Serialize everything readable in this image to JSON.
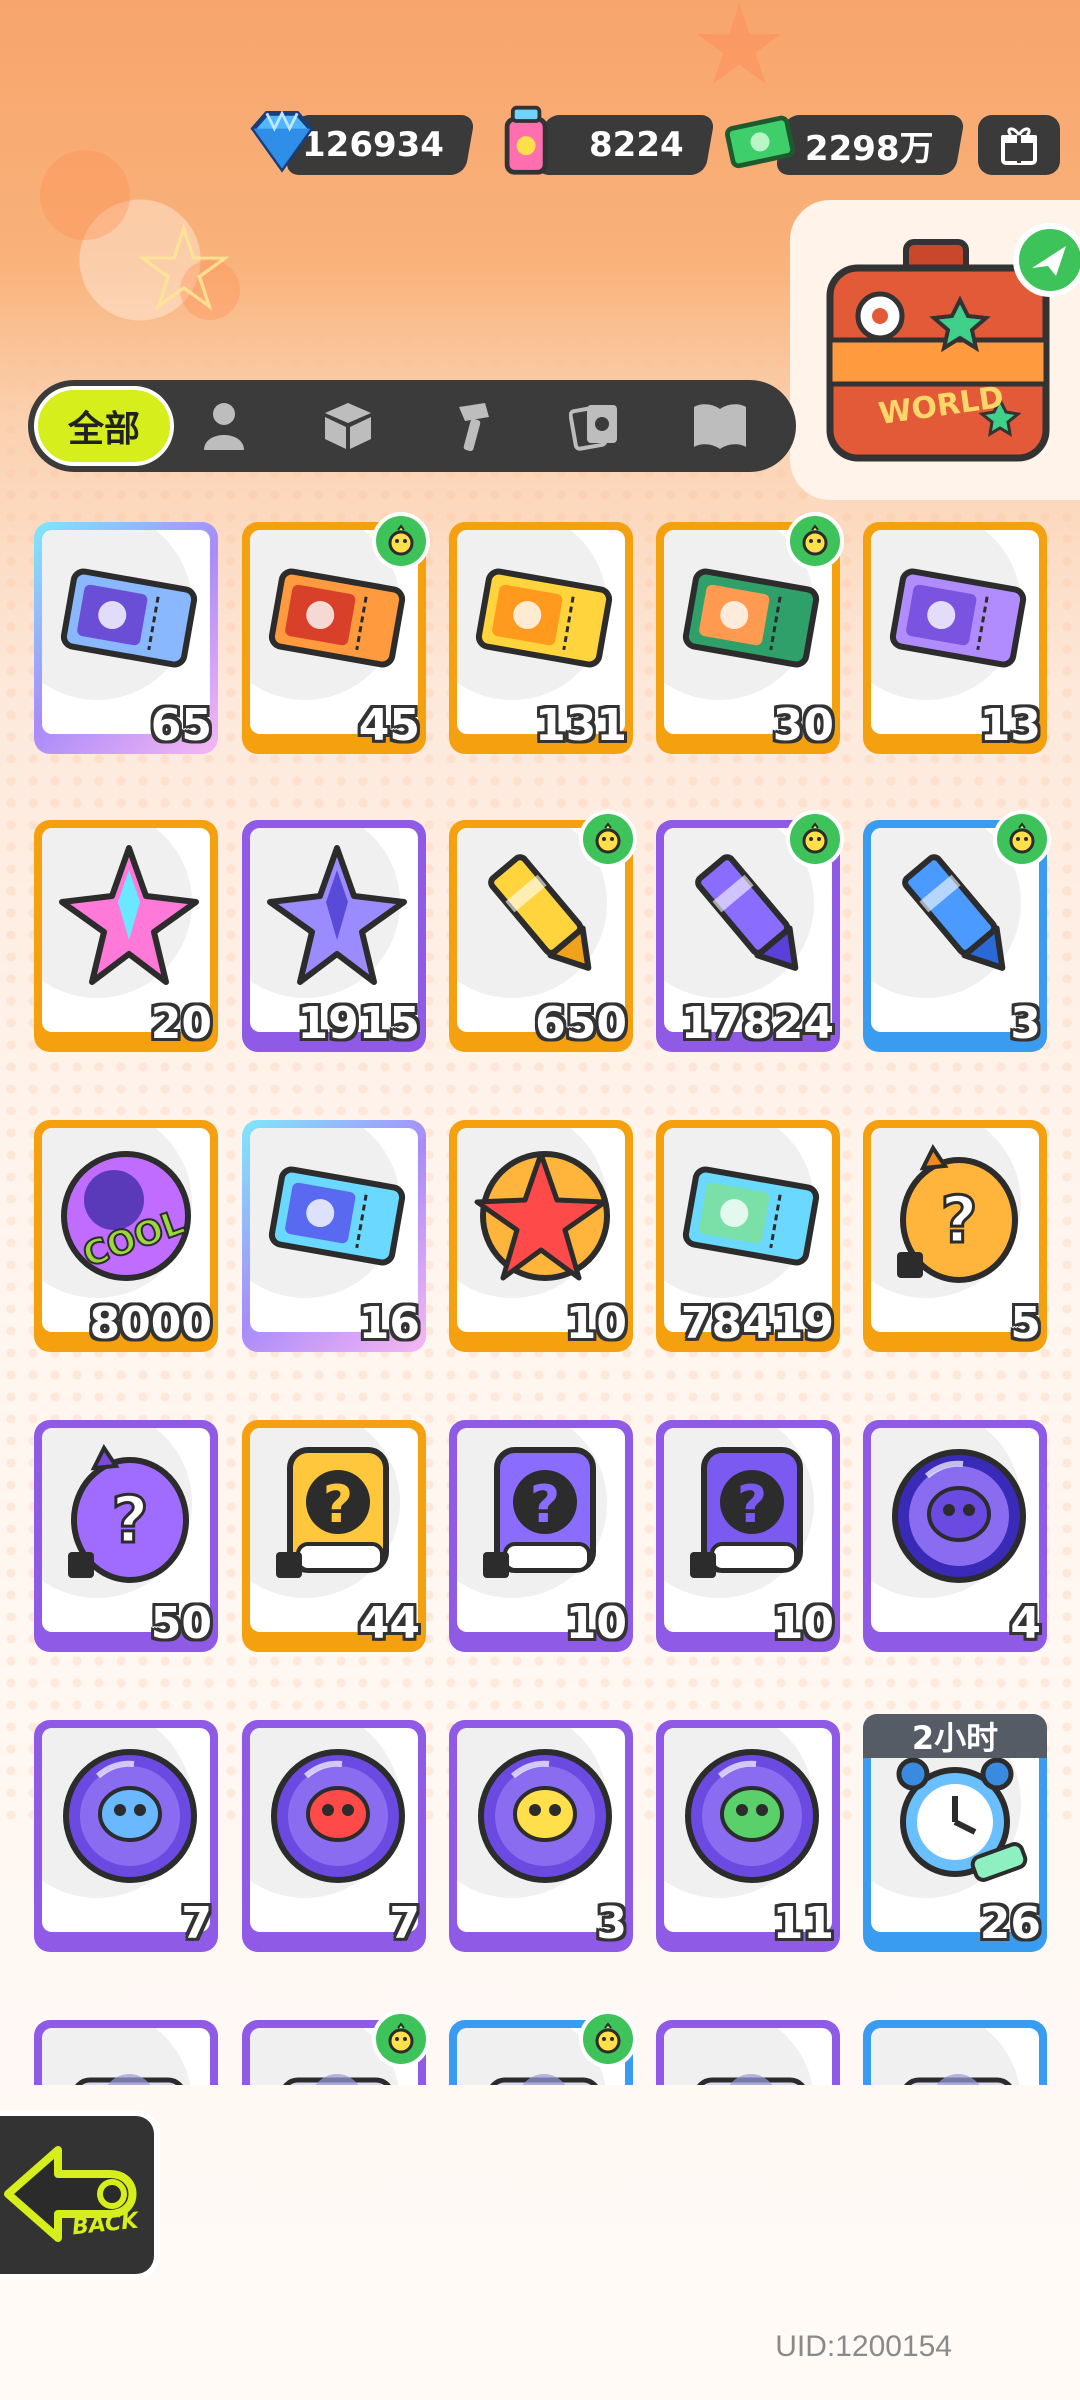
{
  "currencies": [
    {
      "name": "diamond-icon",
      "value": "126934"
    },
    {
      "name": "paint-can-icon",
      "value": "8224"
    },
    {
      "name": "cash-icon",
      "value": "2298万"
    }
  ],
  "travel_bag_label": "WORLD",
  "tabs": {
    "all_label": "全部",
    "icons": [
      "person-icon",
      "box-icon",
      "hammer-icon",
      "cards-icon",
      "book-icon"
    ]
  },
  "items": [
    {
      "count": "65",
      "border": "rainbow",
      "icon": "crown-ticket-icon",
      "seal": false
    },
    {
      "count": "45",
      "border": "orange",
      "icon": "lion-ticket-icon",
      "seal": true
    },
    {
      "count": "131",
      "border": "orange",
      "icon": "star-ticket-icon",
      "seal": false
    },
    {
      "count": "30",
      "border": "orange",
      "icon": "bread-ticket-icon",
      "seal": true
    },
    {
      "count": "13",
      "border": "orange",
      "icon": "purple-star-ticket-icon",
      "seal": false
    },
    {
      "count": "20",
      "border": "orange",
      "icon": "rainbow-crystal-icon",
      "seal": false
    },
    {
      "count": "1915",
      "border": "purple",
      "icon": "purple-crystal-icon",
      "seal": false
    },
    {
      "count": "650",
      "border": "orange",
      "icon": "gold-crayon-icon",
      "seal": true
    },
    {
      "count": "17824",
      "border": "purple",
      "icon": "purple-crayon-icon",
      "seal": true
    },
    {
      "count": "3",
      "border": "blue",
      "icon": "blue-crayon-icon",
      "seal": true
    },
    {
      "count": "8000",
      "border": "orange",
      "icon": "cool-coin-icon",
      "seal": false
    },
    {
      "count": "16",
      "border": "rainbow",
      "icon": "lottery-ticket-icon",
      "seal": false
    },
    {
      "count": "10",
      "border": "orange",
      "icon": "star-badge-icon",
      "seal": false
    },
    {
      "count": "78419",
      "border": "orange",
      "icon": "season-ticket-icon",
      "seal": false
    },
    {
      "count": "5",
      "border": "orange",
      "icon": "mystery-egg-orange-icon",
      "seal": false
    },
    {
      "count": "50",
      "border": "purple",
      "icon": "mystery-egg-purple-icon",
      "seal": false
    },
    {
      "count": "44",
      "border": "orange",
      "icon": "deity-mystery-gold-icon",
      "seal": false
    },
    {
      "count": "10",
      "border": "purple",
      "icon": "deity-mystery-purple-icon",
      "seal": false
    },
    {
      "count": "10",
      "border": "purple",
      "icon": "travel-card-mystery-icon",
      "seal": false
    },
    {
      "count": "4",
      "border": "purple",
      "icon": "bat-orb-icon",
      "seal": false
    },
    {
      "count": "7",
      "border": "purple",
      "icon": "fish-orb-icon",
      "seal": false
    },
    {
      "count": "7",
      "border": "purple",
      "icon": "piranha-orb-icon",
      "seal": false
    },
    {
      "count": "3",
      "border": "purple",
      "icon": "yellow-creature-orb-icon",
      "seal": false
    },
    {
      "count": "11",
      "border": "purple",
      "icon": "plant-orb-icon",
      "seal": false
    },
    {
      "count": "26",
      "border": "blue",
      "icon": "alarm-clock-icon",
      "seal": false,
      "timer": "2小时"
    },
    {
      "count": "",
      "border": "purple",
      "icon": "partial-item-icon",
      "seal": false
    },
    {
      "count": "",
      "border": "purple",
      "icon": "partial-item-icon",
      "seal": true
    },
    {
      "count": "",
      "border": "blue",
      "icon": "partial-item-icon",
      "seal": true
    },
    {
      "count": "",
      "border": "purple",
      "icon": "partial-item-icon",
      "seal": false
    },
    {
      "count": "",
      "border": "blue",
      "icon": "partial-item-icon",
      "seal": false
    }
  ],
  "back_label": "BACK",
  "uid": "UID:1200154"
}
